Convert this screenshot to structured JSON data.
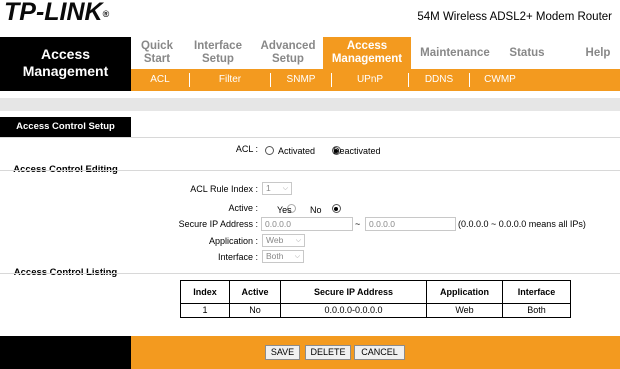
{
  "brand": {
    "logo": "TP-LINK",
    "reg": "®",
    "model": "54M Wireless ADSL2+ Modem Router"
  },
  "left_title": {
    "line1": "Access",
    "line2": "Management"
  },
  "nav": [
    {
      "l1": "Quick",
      "l2": "Start",
      "active": false
    },
    {
      "l1": "Interface",
      "l2": "Setup",
      "active": false
    },
    {
      "l1": "Advanced",
      "l2": "Setup",
      "active": false
    },
    {
      "l1": "Access",
      "l2": "Management",
      "active": true
    },
    {
      "l1": "Maintenance",
      "l2": "",
      "active": false
    },
    {
      "l1": "Status",
      "l2": "",
      "active": false
    },
    {
      "l1": "Help",
      "l2": "",
      "active": false
    }
  ],
  "subnav": [
    "ACL",
    "Filter",
    "SNMP",
    "UPnP",
    "DDNS",
    "CWMP"
  ],
  "sections": {
    "setup": "Access Control Setup",
    "editing": "Access Control Editing",
    "listing": "Access Control Listing"
  },
  "acl": {
    "label": "ACL :",
    "opt_activated": "Activated",
    "opt_deactivated": "Deactivated",
    "selected": "Deactivated"
  },
  "form": {
    "rule_index_label": "ACL Rule Index :",
    "rule_index_value": "1",
    "active_label": "Active :",
    "active_yes": "Yes",
    "active_no": "No",
    "active_selected": "No",
    "secure_ip_label": "Secure IP Address :",
    "ip_start": "0.0.0.0",
    "ip_tilde": "~",
    "ip_end": "0.0.0.0",
    "ip_hint": "(0.0.0.0 ~ 0.0.0.0 means all IPs)",
    "application_label": "Application :",
    "application_value": "Web",
    "interface_label": "Interface :",
    "interface_value": "Both"
  },
  "table": {
    "headers": [
      "Index",
      "Active",
      "Secure IP Address",
      "Application",
      "Interface"
    ],
    "rows": [
      [
        "1",
        "No",
        "0.0.0.0-0.0.0.0",
        "Web",
        "Both"
      ]
    ]
  },
  "buttons": {
    "save": "SAVE",
    "delete": "DELETE",
    "cancel": "CANCEL"
  },
  "colors": {
    "accent": "#f39a1f",
    "dark": "#000000"
  }
}
